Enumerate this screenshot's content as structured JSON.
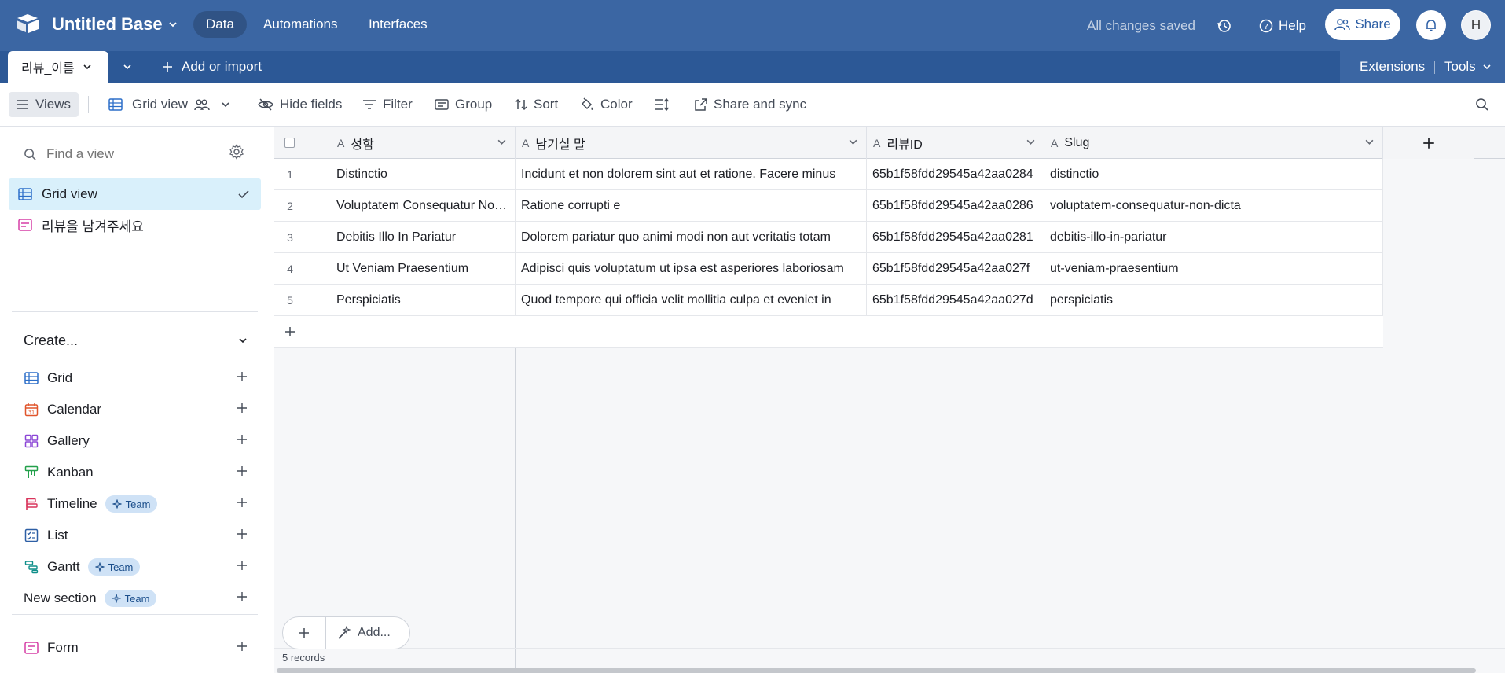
{
  "app": {
    "base_title": "Untitled Base",
    "nav": [
      "Data",
      "Automations",
      "Interfaces"
    ],
    "status": "All changes saved",
    "help_label": "Help",
    "share_label": "Share",
    "avatar_initial": "H"
  },
  "tabs": {
    "active_table": "리뷰_이름",
    "add_import_label": "Add or import",
    "extensions_label": "Extensions",
    "tools_label": "Tools"
  },
  "toolbar": {
    "views_label": "Views",
    "grid_view_label": "Grid view",
    "hide_fields_label": "Hide fields",
    "filter_label": "Filter",
    "group_label": "Group",
    "sort_label": "Sort",
    "color_label": "Color",
    "share_sync_label": "Share and sync"
  },
  "sidebar": {
    "find_placeholder": "Find a view",
    "views": [
      {
        "label": "Grid view",
        "active": true
      },
      {
        "label": "리뷰을 남겨주세요",
        "active": false
      }
    ],
    "create_label": "Create...",
    "create_items": [
      {
        "label": "Grid",
        "team": false
      },
      {
        "label": "Calendar",
        "team": false
      },
      {
        "label": "Gallery",
        "team": false
      },
      {
        "label": "Kanban",
        "team": false
      },
      {
        "label": "Timeline",
        "team": true
      },
      {
        "label": "List",
        "team": false
      },
      {
        "label": "Gantt",
        "team": true
      },
      {
        "label": "New section",
        "team": true
      }
    ],
    "team_label": "Team",
    "form_label": "Form"
  },
  "grid": {
    "columns": [
      "성함",
      "남기실 말",
      "리뷰ID",
      "Slug"
    ],
    "rows": [
      {
        "num": "1",
        "name": "Distinctio",
        "message": "Incidunt et non dolorem sint aut et ratione. Facere minus",
        "id": "65b1f58fdd29545a42aa0284",
        "slug": "distinctio"
      },
      {
        "num": "2",
        "name": "Voluptatem Consequatur Non Dicta",
        "message": "Ratione corrupti e",
        "id": "65b1f58fdd29545a42aa0286",
        "slug": "voluptatem-consequatur-non-dicta"
      },
      {
        "num": "3",
        "name": "Debitis Illo In Pariatur",
        "message": "Dolorem pariatur quo animi modi non aut veritatis totam",
        "id": "65b1f58fdd29545a42aa0281",
        "slug": "debitis-illo-in-pariatur"
      },
      {
        "num": "4",
        "name": "Ut Veniam Praesentium",
        "message": "Adipisci quis voluptatum ut ipsa est asperiores laboriosam",
        "id": "65b1f58fdd29545a42aa027f",
        "slug": "ut-veniam-praesentium"
      },
      {
        "num": "5",
        "name": "Perspiciatis",
        "message": "Quod tempore qui officia velit mollitia culpa et eveniet in",
        "id": "65b1f58fdd29545a42aa027d",
        "slug": "perspiciatis"
      }
    ],
    "add_label": "Add...",
    "records_count": "5 records"
  },
  "colors": {
    "topbar": "#3b66a3",
    "active_view": "#d9f0fb",
    "team_badge": "#cfe2f6"
  }
}
